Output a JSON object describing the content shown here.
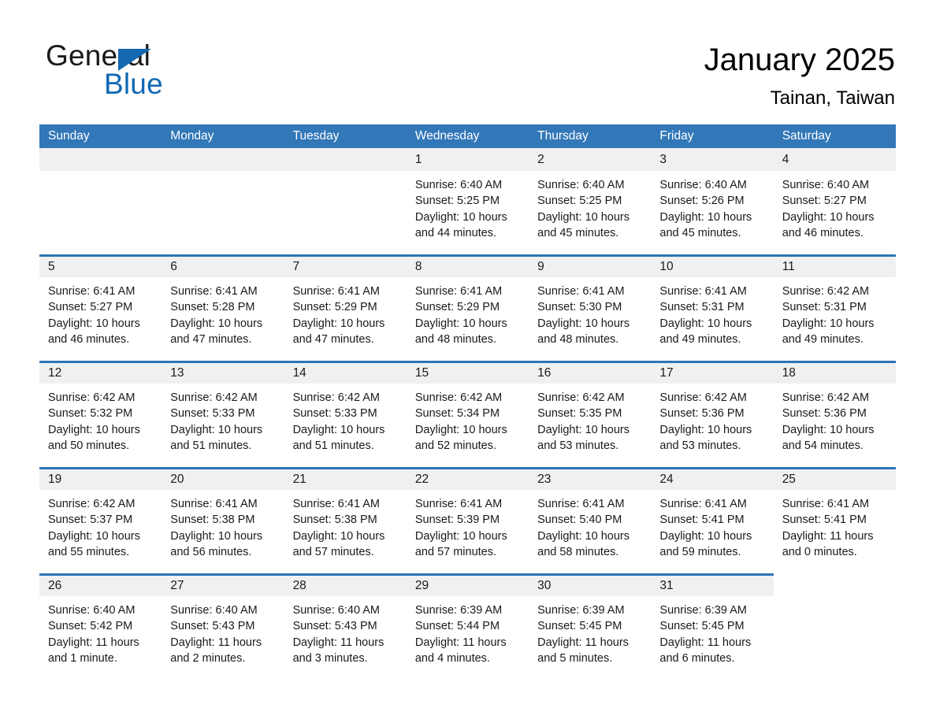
{
  "brand": {
    "name_part1": "General",
    "name_part2": "Blue"
  },
  "header": {
    "title": "January 2025",
    "location": "Tainan, Taiwan"
  },
  "colors": {
    "header_blue": "#3277b8",
    "row_divider_blue": "#2c74b6",
    "daynum_band": "#f0f0f0",
    "logo_blue": "#1068b3"
  },
  "weekdays": [
    "Sunday",
    "Monday",
    "Tuesday",
    "Wednesday",
    "Thursday",
    "Friday",
    "Saturday"
  ],
  "weeks": [
    [
      {
        "day": "",
        "lines": []
      },
      {
        "day": "",
        "lines": []
      },
      {
        "day": "",
        "lines": []
      },
      {
        "day": "1",
        "lines": [
          "Sunrise: 6:40 AM",
          "Sunset: 5:25 PM",
          "Daylight: 10 hours",
          "and 44 minutes."
        ]
      },
      {
        "day": "2",
        "lines": [
          "Sunrise: 6:40 AM",
          "Sunset: 5:25 PM",
          "Daylight: 10 hours",
          "and 45 minutes."
        ]
      },
      {
        "day": "3",
        "lines": [
          "Sunrise: 6:40 AM",
          "Sunset: 5:26 PM",
          "Daylight: 10 hours",
          "and 45 minutes."
        ]
      },
      {
        "day": "4",
        "lines": [
          "Sunrise: 6:40 AM",
          "Sunset: 5:27 PM",
          "Daylight: 10 hours",
          "and 46 minutes."
        ]
      }
    ],
    [
      {
        "day": "5",
        "lines": [
          "Sunrise: 6:41 AM",
          "Sunset: 5:27 PM",
          "Daylight: 10 hours",
          "and 46 minutes."
        ]
      },
      {
        "day": "6",
        "lines": [
          "Sunrise: 6:41 AM",
          "Sunset: 5:28 PM",
          "Daylight: 10 hours",
          "and 47 minutes."
        ]
      },
      {
        "day": "7",
        "lines": [
          "Sunrise: 6:41 AM",
          "Sunset: 5:29 PM",
          "Daylight: 10 hours",
          "and 47 minutes."
        ]
      },
      {
        "day": "8",
        "lines": [
          "Sunrise: 6:41 AM",
          "Sunset: 5:29 PM",
          "Daylight: 10 hours",
          "and 48 minutes."
        ]
      },
      {
        "day": "9",
        "lines": [
          "Sunrise: 6:41 AM",
          "Sunset: 5:30 PM",
          "Daylight: 10 hours",
          "and 48 minutes."
        ]
      },
      {
        "day": "10",
        "lines": [
          "Sunrise: 6:41 AM",
          "Sunset: 5:31 PM",
          "Daylight: 10 hours",
          "and 49 minutes."
        ]
      },
      {
        "day": "11",
        "lines": [
          "Sunrise: 6:42 AM",
          "Sunset: 5:31 PM",
          "Daylight: 10 hours",
          "and 49 minutes."
        ]
      }
    ],
    [
      {
        "day": "12",
        "lines": [
          "Sunrise: 6:42 AM",
          "Sunset: 5:32 PM",
          "Daylight: 10 hours",
          "and 50 minutes."
        ]
      },
      {
        "day": "13",
        "lines": [
          "Sunrise: 6:42 AM",
          "Sunset: 5:33 PM",
          "Daylight: 10 hours",
          "and 51 minutes."
        ]
      },
      {
        "day": "14",
        "lines": [
          "Sunrise: 6:42 AM",
          "Sunset: 5:33 PM",
          "Daylight: 10 hours",
          "and 51 minutes."
        ]
      },
      {
        "day": "15",
        "lines": [
          "Sunrise: 6:42 AM",
          "Sunset: 5:34 PM",
          "Daylight: 10 hours",
          "and 52 minutes."
        ]
      },
      {
        "day": "16",
        "lines": [
          "Sunrise: 6:42 AM",
          "Sunset: 5:35 PM",
          "Daylight: 10 hours",
          "and 53 minutes."
        ]
      },
      {
        "day": "17",
        "lines": [
          "Sunrise: 6:42 AM",
          "Sunset: 5:36 PM",
          "Daylight: 10 hours",
          "and 53 minutes."
        ]
      },
      {
        "day": "18",
        "lines": [
          "Sunrise: 6:42 AM",
          "Sunset: 5:36 PM",
          "Daylight: 10 hours",
          "and 54 minutes."
        ]
      }
    ],
    [
      {
        "day": "19",
        "lines": [
          "Sunrise: 6:42 AM",
          "Sunset: 5:37 PM",
          "Daylight: 10 hours",
          "and 55 minutes."
        ]
      },
      {
        "day": "20",
        "lines": [
          "Sunrise: 6:41 AM",
          "Sunset: 5:38 PM",
          "Daylight: 10 hours",
          "and 56 minutes."
        ]
      },
      {
        "day": "21",
        "lines": [
          "Sunrise: 6:41 AM",
          "Sunset: 5:38 PM",
          "Daylight: 10 hours",
          "and 57 minutes."
        ]
      },
      {
        "day": "22",
        "lines": [
          "Sunrise: 6:41 AM",
          "Sunset: 5:39 PM",
          "Daylight: 10 hours",
          "and 57 minutes."
        ]
      },
      {
        "day": "23",
        "lines": [
          "Sunrise: 6:41 AM",
          "Sunset: 5:40 PM",
          "Daylight: 10 hours",
          "and 58 minutes."
        ]
      },
      {
        "day": "24",
        "lines": [
          "Sunrise: 6:41 AM",
          "Sunset: 5:41 PM",
          "Daylight: 10 hours",
          "and 59 minutes."
        ]
      },
      {
        "day": "25",
        "lines": [
          "Sunrise: 6:41 AM",
          "Sunset: 5:41 PM",
          "Daylight: 11 hours",
          "and 0 minutes."
        ]
      }
    ],
    [
      {
        "day": "26",
        "lines": [
          "Sunrise: 6:40 AM",
          "Sunset: 5:42 PM",
          "Daylight: 11 hours",
          "and 1 minute."
        ]
      },
      {
        "day": "27",
        "lines": [
          "Sunrise: 6:40 AM",
          "Sunset: 5:43 PM",
          "Daylight: 11 hours",
          "and 2 minutes."
        ]
      },
      {
        "day": "28",
        "lines": [
          "Sunrise: 6:40 AM",
          "Sunset: 5:43 PM",
          "Daylight: 11 hours",
          "and 3 minutes."
        ]
      },
      {
        "day": "29",
        "lines": [
          "Sunrise: 6:39 AM",
          "Sunset: 5:44 PM",
          "Daylight: 11 hours",
          "and 4 minutes."
        ]
      },
      {
        "day": "30",
        "lines": [
          "Sunrise: 6:39 AM",
          "Sunset: 5:45 PM",
          "Daylight: 11 hours",
          "and 5 minutes."
        ]
      },
      {
        "day": "31",
        "lines": [
          "Sunrise: 6:39 AM",
          "Sunset: 5:45 PM",
          "Daylight: 11 hours",
          "and 6 minutes."
        ]
      },
      {
        "day": "",
        "lines": []
      }
    ]
  ]
}
